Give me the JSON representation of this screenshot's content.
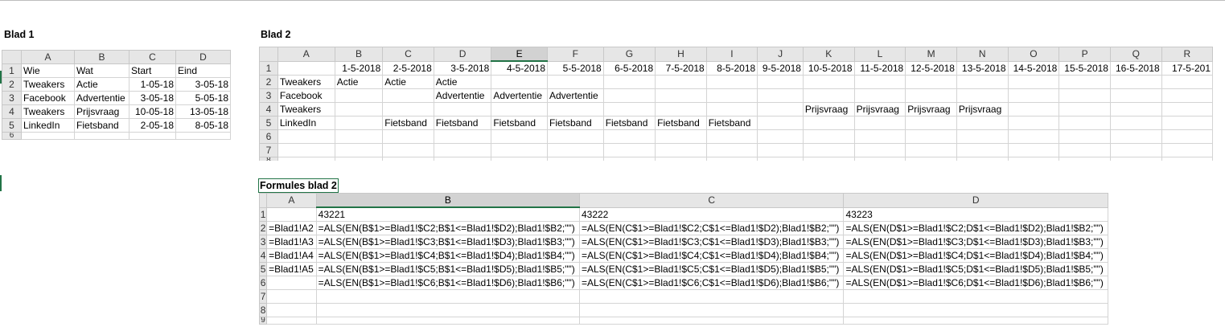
{
  "blad1": {
    "title": "Blad 1",
    "columns": [
      "A",
      "B",
      "C",
      "D"
    ],
    "rows": [
      {
        "num": "1",
        "cells": [
          "Wie",
          "Wat",
          "Start",
          "Eind"
        ]
      },
      {
        "num": "2",
        "cells": [
          "Tweakers",
          "Actie",
          "1-05-18",
          "3-05-18"
        ]
      },
      {
        "num": "3",
        "cells": [
          "Facebook",
          "Advertentie",
          "3-05-18",
          "5-05-18"
        ]
      },
      {
        "num": "4",
        "cells": [
          "Tweakers",
          "Prijsvraag",
          "10-05-18",
          "13-05-18"
        ]
      },
      {
        "num": "5",
        "cells": [
          "LinkedIn",
          "Fietsband",
          "2-05-18",
          "8-05-18"
        ]
      },
      {
        "num": "6",
        "cells": [
          "",
          "",
          "",
          ""
        ]
      }
    ]
  },
  "blad2": {
    "title": "Blad 2",
    "columns": [
      "A",
      "B",
      "C",
      "D",
      "E",
      "F",
      "G",
      "H",
      "I",
      "J",
      "K",
      "L",
      "M",
      "N",
      "O",
      "P",
      "Q",
      "R"
    ],
    "selected_column": "E",
    "rows": [
      {
        "num": "1",
        "cells": [
          "",
          "1-5-2018",
          "2-5-2018",
          "3-5-2018",
          "4-5-2018",
          "5-5-2018",
          "6-5-2018",
          "7-5-2018",
          "8-5-2018",
          "9-5-2018",
          "10-5-2018",
          "11-5-2018",
          "12-5-2018",
          "13-5-2018",
          "14-5-2018",
          "15-5-2018",
          "16-5-2018",
          "17-5-201"
        ]
      },
      {
        "num": "2",
        "cells": [
          "Tweakers",
          "Actie",
          "Actie",
          "Actie",
          "",
          "",
          "",
          "",
          "",
          "",
          "",
          "",
          "",
          "",
          "",
          "",
          "",
          ""
        ]
      },
      {
        "num": "3",
        "cells": [
          "Facebook",
          "",
          "",
          "Advertentie",
          "Advertentie",
          "Advertentie",
          "",
          "",
          "",
          "",
          "",
          "",
          "",
          "",
          "",
          "",
          "",
          ""
        ]
      },
      {
        "num": "4",
        "cells": [
          "Tweakers",
          "",
          "",
          "",
          "",
          "",
          "",
          "",
          "",
          "",
          "Prijsvraag",
          "Prijsvraag",
          "Prijsvraag",
          "Prijsvraag",
          "",
          "",
          "",
          ""
        ]
      },
      {
        "num": "5",
        "cells": [
          "LinkedIn",
          "",
          "Fietsband",
          "Fietsband",
          "Fietsband",
          "Fietsband",
          "Fietsband",
          "Fietsband",
          "Fietsband",
          "",
          "",
          "",
          "",
          "",
          "",
          "",
          "",
          ""
        ]
      },
      {
        "num": "6",
        "cells": [
          "",
          "",
          "",
          "",
          "",
          "",
          "",
          "",
          "",
          "",
          "",
          "",
          "",
          "",
          "",
          "",
          "",
          ""
        ]
      },
      {
        "num": "7",
        "cells": [
          "",
          "",
          "",
          "",
          "",
          "",
          "",
          "",
          "",
          "",
          "",
          "",
          "",
          "",
          "",
          "",
          "",
          ""
        ]
      },
      {
        "num": "8",
        "cells": [
          "",
          "",
          "",
          "",
          "",
          "",
          "",
          "",
          "",
          "",
          "",
          "",
          "",
          "",
          "",
          "",
          "",
          ""
        ]
      }
    ]
  },
  "formules": {
    "title": "Formules blad 2",
    "columns": [
      "A",
      "B",
      "C",
      "D"
    ],
    "selected_column": "B",
    "rows": [
      {
        "num": "1",
        "cells": [
          "",
          "43221",
          "43222",
          "43223"
        ]
      },
      {
        "num": "2",
        "cells": [
          "=Blad1!A2",
          "=ALS(EN(B$1>=Blad1!$C2;B$1<=Blad1!$D2);Blad1!$B2;\"\")",
          "=ALS(EN(C$1>=Blad1!$C2;C$1<=Blad1!$D2);Blad1!$B2;\"\")",
          "=ALS(EN(D$1>=Blad1!$C2;D$1<=Blad1!$D2);Blad1!$B2;\"\")"
        ]
      },
      {
        "num": "3",
        "cells": [
          "=Blad1!A3",
          "=ALS(EN(B$1>=Blad1!$C3;B$1<=Blad1!$D3);Blad1!$B3;\"\")",
          "=ALS(EN(C$1>=Blad1!$C3;C$1<=Blad1!$D3);Blad1!$B3;\"\")",
          "=ALS(EN(D$1>=Blad1!$C3;D$1<=Blad1!$D3);Blad1!$B3;\"\")"
        ]
      },
      {
        "num": "4",
        "cells": [
          "=Blad1!A4",
          "=ALS(EN(B$1>=Blad1!$C4;B$1<=Blad1!$D4);Blad1!$B4;\"\")",
          "=ALS(EN(C$1>=Blad1!$C4;C$1<=Blad1!$D4);Blad1!$B4;\"\")",
          "=ALS(EN(D$1>=Blad1!$C4;D$1<=Blad1!$D4);Blad1!$B4;\"\")"
        ]
      },
      {
        "num": "5",
        "cells": [
          "=Blad1!A5",
          "=ALS(EN(B$1>=Blad1!$C5;B$1<=Blad1!$D5);Blad1!$B5;\"\")",
          "=ALS(EN(C$1>=Blad1!$C5;C$1<=Blad1!$D5);Blad1!$B5;\"\")",
          "=ALS(EN(D$1>=Blad1!$C5;D$1<=Blad1!$D5);Blad1!$B5;\"\")"
        ]
      },
      {
        "num": "6",
        "cells": [
          "",
          "=ALS(EN(B$1>=Blad1!$C6;B$1<=Blad1!$D6);Blad1!$B6;\"\")",
          "=ALS(EN(C$1>=Blad1!$C6;C$1<=Blad1!$D6);Blad1!$B6;\"\")",
          "=ALS(EN(D$1>=Blad1!$C6;D$1<=Blad1!$D6);Blad1!$B6;\"\")"
        ]
      },
      {
        "num": "7",
        "cells": [
          "",
          "",
          "",
          ""
        ]
      },
      {
        "num": "8",
        "cells": [
          "",
          "",
          "",
          ""
        ]
      },
      {
        "num": "9",
        "cells": [
          "",
          "",
          "",
          ""
        ]
      }
    ]
  }
}
